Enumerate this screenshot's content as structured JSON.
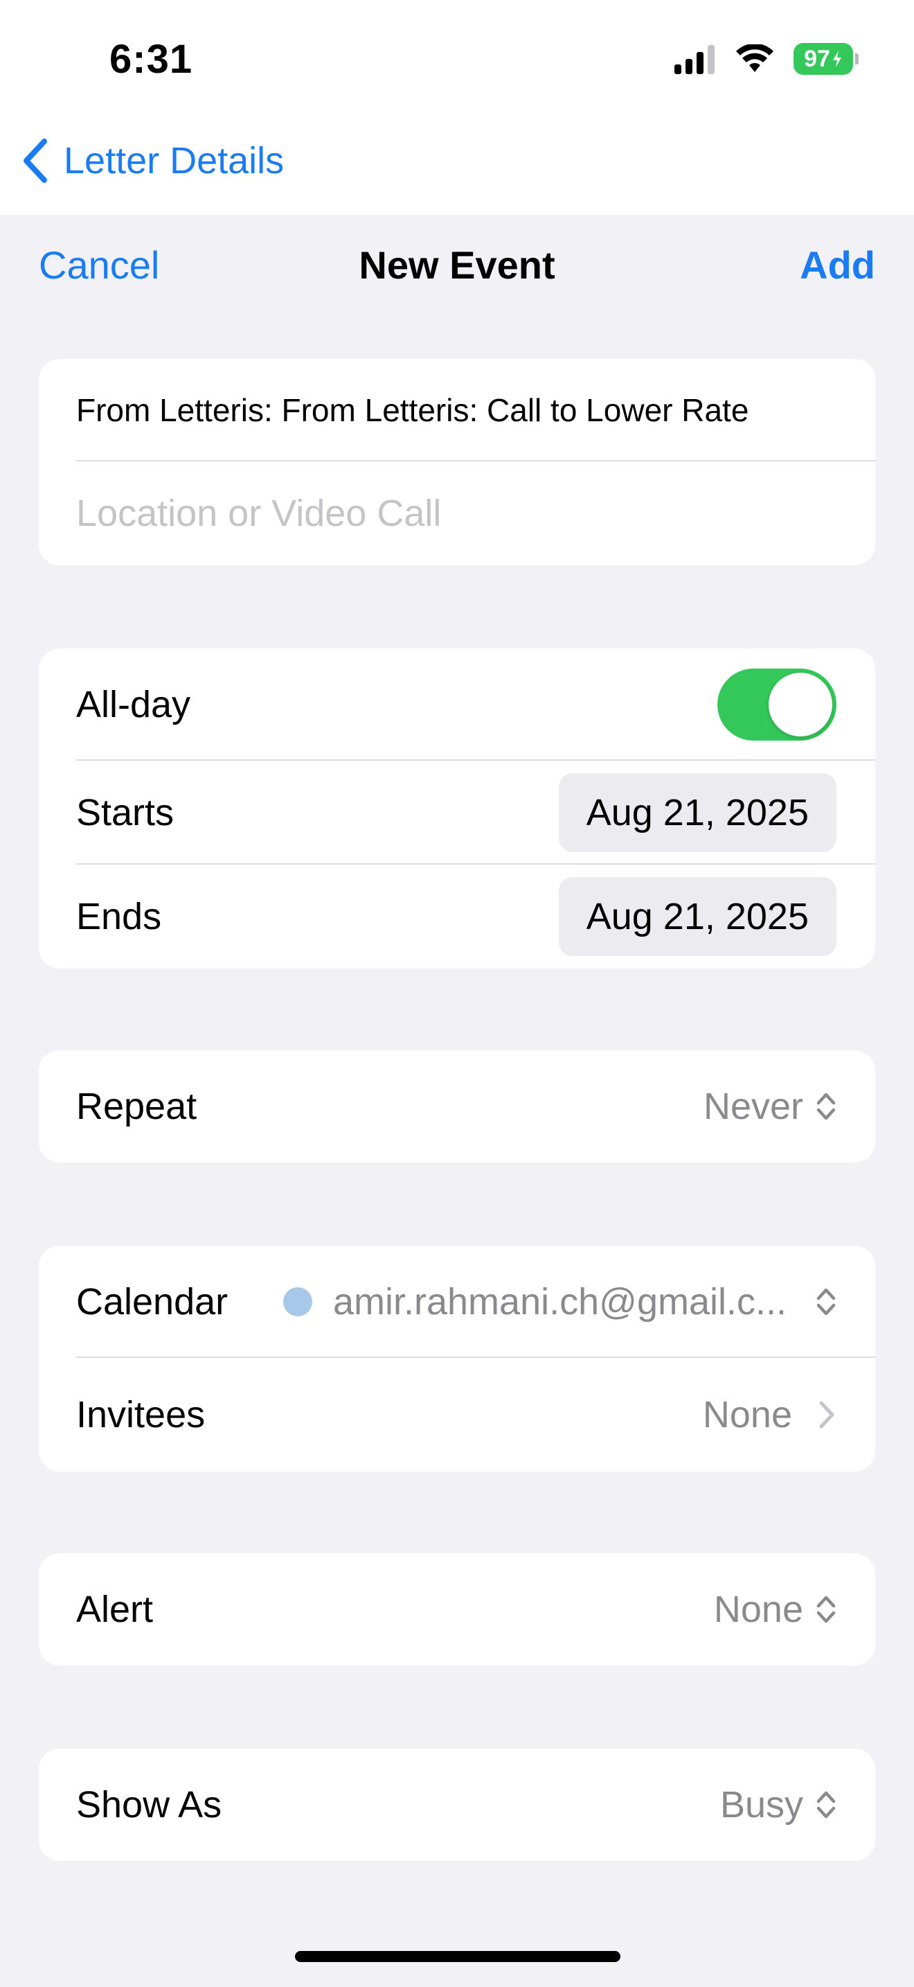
{
  "status": {
    "time": "6:31",
    "battery": "97"
  },
  "nav": {
    "back_label": "Letter Details"
  },
  "header": {
    "cancel": "Cancel",
    "title": "New Event",
    "add": "Add"
  },
  "title_card": {
    "title_value": "From Letteris: From Letteris: Call to Lower Rate",
    "location_placeholder": "Location or Video Call"
  },
  "time_card": {
    "allday_label": "All-day",
    "starts_label": "Starts",
    "starts_value": "Aug 21, 2025",
    "ends_label": "Ends",
    "ends_value": "Aug 21, 2025"
  },
  "repeat": {
    "label": "Repeat",
    "value": "Never"
  },
  "calendar": {
    "label": "Calendar",
    "value": "amir.rahmani.ch@gmail.c...",
    "dot_color": "#a8c8ea",
    "invitees_label": "Invitees",
    "invitees_value": "None"
  },
  "alert": {
    "label": "Alert",
    "value": "None"
  },
  "show_as": {
    "label": "Show As",
    "value": "Busy"
  },
  "colors": {
    "accent": "#1a7cf2",
    "toggle_on": "#34c759"
  }
}
